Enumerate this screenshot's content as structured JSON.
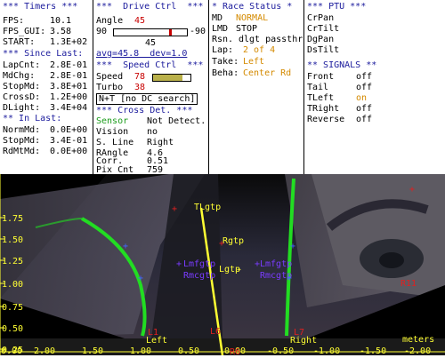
{
  "timers": {
    "header": "*** Timers ***",
    "fps_label": "FPS:",
    "fps": "10.1",
    "fps_gui_label": "FPS_GUI:",
    "fps_gui": "3.58",
    "start_label": "START:",
    "start": "1.3E+02",
    "since_last": "*** Since Last:",
    "lapcnt_label": "LapCnt:",
    "lapcnt": "2.8E-01",
    "mdchg_label": "MdChg:",
    "mdchg": "2.8E-01",
    "stopmd_label": "StopMd:",
    "stopmd": "3.8E+01",
    "crossd_label": "CrossD:",
    "crossd": "1.2E+00",
    "dlight_label": "DLight:",
    "dlight": "3.4E+04",
    "in_last": "** In Last:",
    "normmd_label": "NormMd:",
    "normmd": "0.0E+00",
    "stopmd2_label": "StopMd:",
    "stopmd2": "3.4E-01",
    "rdmtmd_label": "RdMtMd:",
    "rdmtmd": "0.0E+00"
  },
  "drive": {
    "header": "***  Drive Ctrl  ***",
    "angle_label": "Angle",
    "angle": "45",
    "range_min": "90",
    "range_max": "-90",
    "angle_center": "45",
    "angle_level": 0.75,
    "avg_text": "avg=45.8  dev=1.0",
    "speed_header": "***  Speed Ctrl  ***",
    "speed_label": "Speed",
    "speed": "78",
    "speed_level": 0.78,
    "turbo_label": "Turbo",
    "turbo": "38",
    "search_text": "N+T [no DC search]",
    "cross_header": "*** Cross Det. ***",
    "sensor_label": "Sensor",
    "sensor": "Not Detect.",
    "vision_label": "Vision",
    "vision": "no",
    "sline_label": "S. Line",
    "sline": "Right",
    "rangle_label": "RAngle",
    "rangle": "4.6",
    "corr_label": "Corr.",
    "corr": "0.51",
    "pixcnt_label": "Pix Cnt",
    "pixcnt": "759"
  },
  "race": {
    "header": "* Race Status *",
    "md_label": "MD",
    "md": "NORMAL",
    "lmd_label": "LMD",
    "lmd": "STOP",
    "rsn_label": "Rsn.",
    "rsn": "dlgt passthroDgRan",
    "lap_label": "Lap:",
    "lap": "2 of 4",
    "take_label": "Take:",
    "take": "Left",
    "beha_label": "Beha:",
    "beha": "Center Rd"
  },
  "ptu": {
    "header": "*** PTU ***",
    "items": [
      "CrPan",
      "CrTilt",
      "DgPan",
      "DsTilt"
    ],
    "signals_header": "** SIGNALS **",
    "signals": [
      {
        "name": "Front",
        "state": "off"
      },
      {
        "name": "Tail",
        "state": "off"
      },
      {
        "name": "TLeft",
        "state": "on"
      },
      {
        "name": "TRight",
        "state": "off"
      },
      {
        "name": "Reverse",
        "state": "off"
      }
    ]
  },
  "scene": {
    "y_ticks": [
      "1.75",
      "1.50",
      "1.25",
      "1.00",
      "0.75",
      "0.50",
      "0.25",
      "0.00"
    ],
    "x_ticks": [
      "2.00",
      "1.50",
      "1.00",
      "0.50",
      "0.00",
      "-0.50",
      "-1.00",
      "-1.50",
      "-2.00"
    ],
    "units": "meters",
    "markers": {
      "tlgtp": "TLgtp",
      "rgtp": "Rgtp",
      "lgtp": "Lgtp",
      "lmfgtp_l": "Lmfgtp",
      "lmfgtp_r": "Lmfgtp",
      "rmcgtp_l": "Rmcgtp",
      "rmcgtp_r": "Rmcgtp",
      "left": "Left",
      "right": "Right",
      "l1": "L1",
      "l7": "L7",
      "r11": "R11",
      "l6": "L6",
      "r6": "R6"
    }
  },
  "colors": {
    "accent_blue": "#1a1a9c",
    "signal_on": "#d48a00",
    "lane_green": "#22dd22",
    "marker_yellow": "#ffff33"
  }
}
